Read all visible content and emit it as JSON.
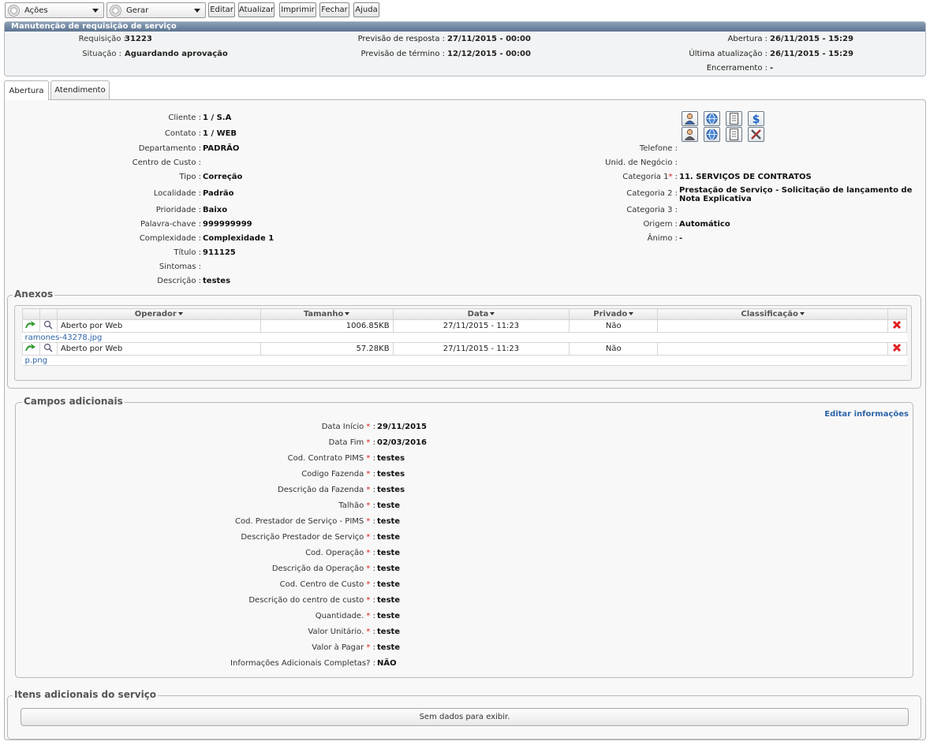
{
  "toolbar": {
    "actions_label": "Ações",
    "generate_label": "Gerar",
    "buttons": [
      "Editar",
      "Atualizar",
      "Imprimir",
      "Fechar",
      "Ajuda"
    ]
  },
  "header": {
    "title": "Manutenção de requisição de serviço",
    "requisicao_label": "Requisição :",
    "requisicao": "31223",
    "situacao_label": "Situação :",
    "situacao": "Aguardando aprovação",
    "previsao_resposta_label": "Previsão de resposta :",
    "previsao_resposta": "27/11/2015 - 00:00",
    "previsao_termino_label": "Previsão de término :",
    "previsao_termino": "12/12/2015 - 00:00",
    "abertura_label": "Abertura :",
    "abertura": "26/11/2015 - 15:29",
    "ultima_label": "Última atualização :",
    "ultima": "26/11/2015 - 15:29",
    "encerramento_label": "Encerramento :",
    "encerramento": "-"
  },
  "tabs": [
    "Abertura",
    "Atendimento"
  ],
  "left_fields": [
    {
      "label": "Cliente :",
      "value": "1 / S.A"
    },
    {
      "label": "Contato :",
      "value": "1 / WEB"
    },
    {
      "label": "Departamento :",
      "value": "PADRÃO"
    },
    {
      "label": "Centro de Custo :",
      "value": ""
    },
    {
      "label": "Tipo :",
      "value": "Correção"
    },
    {
      "label": "Localidade :",
      "value": "Padrão"
    },
    {
      "label": "Prioridade :",
      "value": "Baixo"
    },
    {
      "label": "Palavra-chave :",
      "value": "999999999"
    },
    {
      "label": "Complexidade :",
      "value": "Complexidade 1"
    },
    {
      "label": "Título :",
      "value": "911125"
    },
    {
      "label": "Sintomas :",
      "value": ""
    },
    {
      "label": "Descrição :",
      "value": "testes"
    }
  ],
  "right_fields": [
    {
      "label": "Telefone :",
      "value": ""
    },
    {
      "label": "Unid. de Negócio :",
      "value": ""
    },
    {
      "label": "Categoria 1",
      "value": "11. SERVIÇOS DE CONTRATOS"
    },
    {
      "label": "Categoria 2 :",
      "value": "Prestação de Serviço - Solicitação de lançamento de Nota Explicativa"
    },
    {
      "label": "Categoria 3 :",
      "value": ""
    },
    {
      "label": "Origem :",
      "value": "Automático"
    },
    {
      "label": "Ânimo :",
      "value": "-"
    }
  ],
  "icon_buttons": [
    "user-icon",
    "globe-icon",
    "document-icon",
    "dollar-icon",
    "user-icon",
    "globe-icon",
    "document-icon",
    "tools-icon"
  ],
  "colors": {
    "accent": "#2c64a8",
    "required": "#d22222",
    "header_bar": "#6a829c"
  },
  "anexos": {
    "legend": "Anexos",
    "columns": [
      "Operador",
      "Tamanho",
      "Data",
      "Privado",
      "Classificação"
    ],
    "rows": [
      {
        "operador": "Aberto por Web",
        "tamanho": "1006.85KB",
        "data": "27/11/2015 - 11:23",
        "privado": "Não",
        "classificacao": "",
        "file": "ramones-43278.jpg"
      },
      {
        "operador": "Aberto por Web",
        "tamanho": "57.28KB",
        "data": "27/11/2015 - 11:23",
        "privado": "Não",
        "classificacao": "",
        "file": "p.png"
      }
    ]
  },
  "campos": {
    "legend": "Campos adicionais",
    "edit_link": "Editar informações",
    "fields": [
      {
        "label": "Data Início",
        "required": true,
        "value": "29/11/2015"
      },
      {
        "label": "Data Fim",
        "required": true,
        "value": "02/03/2016"
      },
      {
        "label": "Cod. Contrato PIMS",
        "required": true,
        "value": "testes"
      },
      {
        "label": "Codigo Fazenda",
        "required": true,
        "value": "testes"
      },
      {
        "label": "Descrição da Fazenda",
        "required": true,
        "value": "testes"
      },
      {
        "label": "Talhão",
        "required": true,
        "value": "teste"
      },
      {
        "label": "Cod. Prestador de Serviço - PIMS",
        "required": true,
        "value": "teste"
      },
      {
        "label": "Descrição Prestador de Serviço",
        "required": true,
        "value": "teste"
      },
      {
        "label": "Cod. Operação",
        "required": true,
        "value": "teste"
      },
      {
        "label": "Descrição da Operação",
        "required": true,
        "value": "teste"
      },
      {
        "label": "Cod. Centro de Custo",
        "required": true,
        "value": "teste"
      },
      {
        "label": "Descrição do centro de custo",
        "required": true,
        "value": "teste"
      },
      {
        "label": "Quantidade.",
        "required": true,
        "value": "teste"
      },
      {
        "label": "Valor Unitário.",
        "required": true,
        "value": "teste"
      },
      {
        "label": "Valor à Pagar",
        "required": true,
        "value": "teste"
      },
      {
        "label": "Informações Adicionais Completas?",
        "required": false,
        "value": "NÃO"
      }
    ]
  },
  "itens": {
    "legend": "Itens adicionais do serviço",
    "empty": "Sem dados para exibir."
  }
}
